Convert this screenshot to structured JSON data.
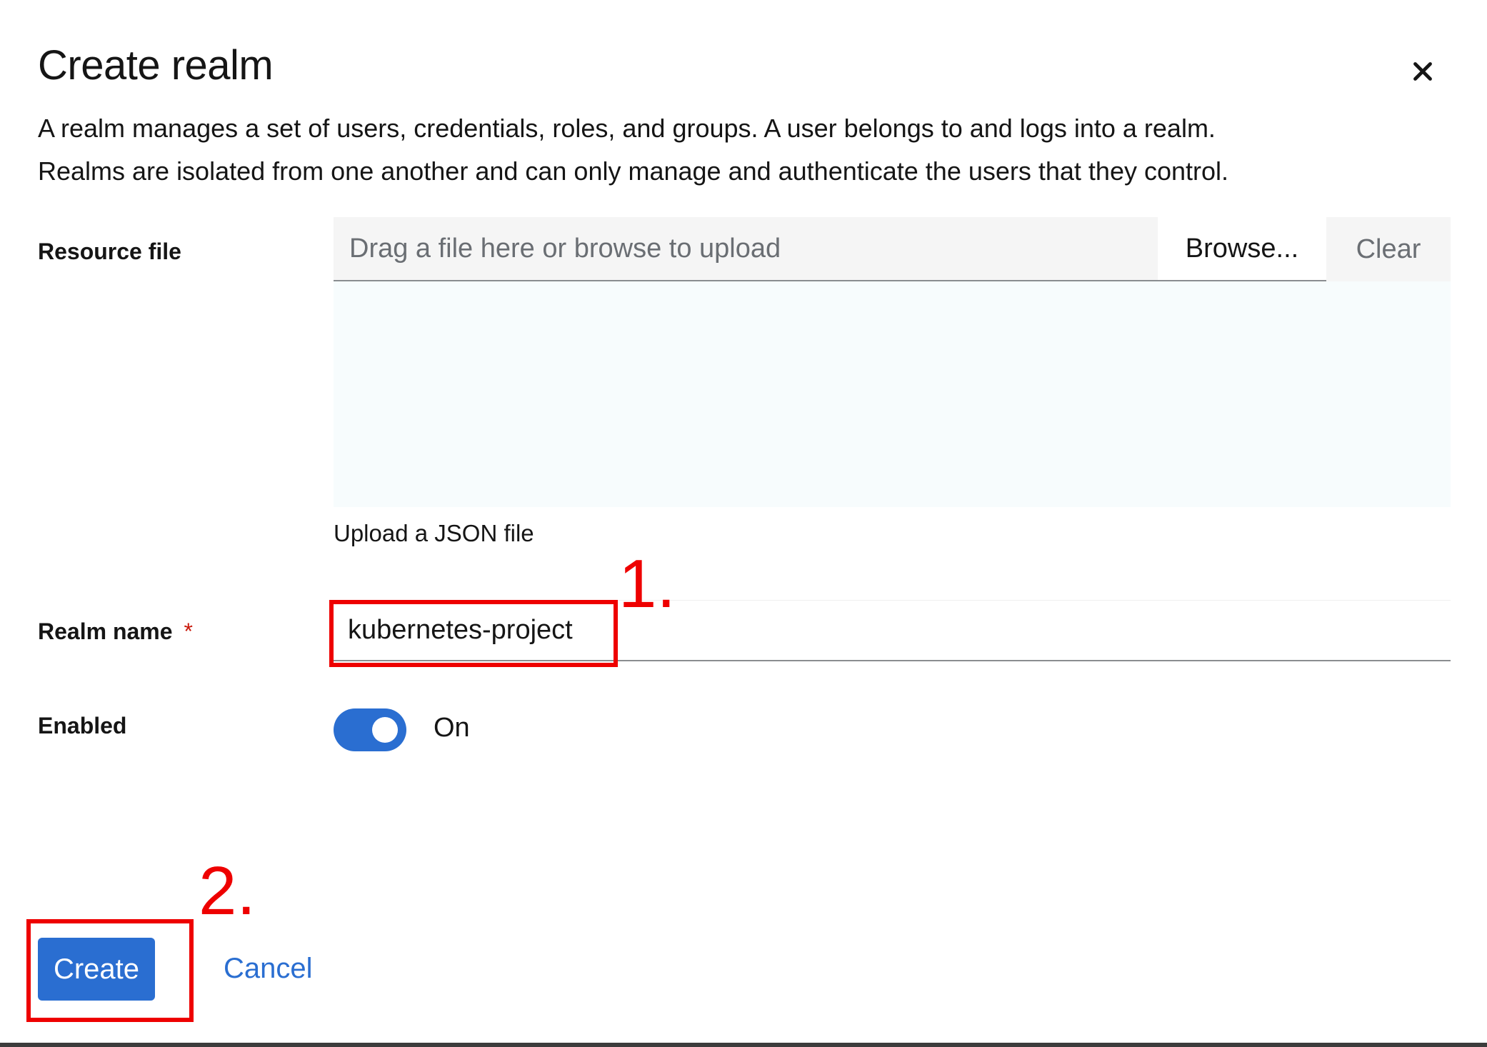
{
  "modal": {
    "title": "Create realm",
    "description_line1": "A realm manages a set of users, credentials, roles, and groups. A user belongs to and logs into a realm.",
    "description_line2": "Realms are isolated from one another and can only manage and authenticate the users that they control.",
    "close_icon": "close-icon"
  },
  "form": {
    "resource_file": {
      "label": "Resource file",
      "placeholder": "Drag a file here or browse to upload",
      "browse_label": "Browse...",
      "clear_label": "Clear",
      "helper_text": "Upload a JSON file"
    },
    "realm_name": {
      "label": "Realm name",
      "required_marker": "*",
      "value": "kubernetes-project"
    },
    "enabled": {
      "label": "Enabled",
      "state_text": "On",
      "on": true
    }
  },
  "actions": {
    "create_label": "Create",
    "cancel_label": "Cancel"
  },
  "annotations": {
    "step1": "1.",
    "step2": "2."
  },
  "colors": {
    "primary": "#2a6ed1",
    "annotation": "#ee0000",
    "required": "#c9190b"
  }
}
